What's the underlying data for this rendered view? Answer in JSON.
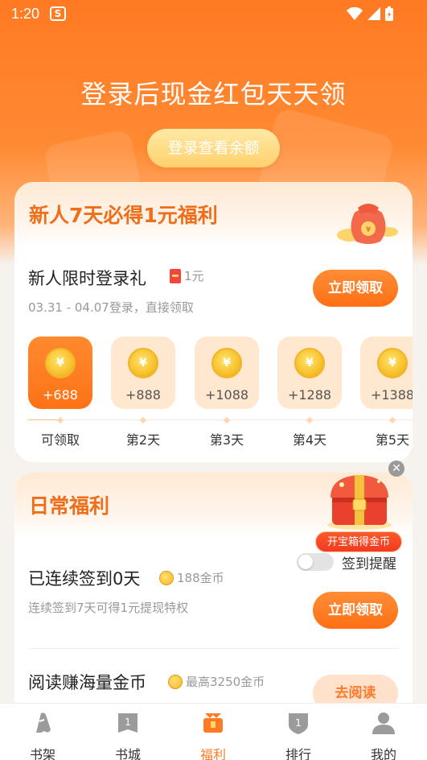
{
  "status_bar": {
    "time": "1:20",
    "app_icon_letter": "S"
  },
  "hero": {
    "title": "登录后现金红包天天领",
    "login_button": "登录查看余额"
  },
  "newbie_card": {
    "title": "新人7天必得1元福利",
    "task_title": "新人限时登录礼",
    "reward_tag": "1元",
    "subtitle": "03.31 - 04.07登录，直接领取",
    "button": "立即领取",
    "coin_symbol": "¥",
    "days": [
      {
        "amount": "+688",
        "label": "可领取",
        "active": true
      },
      {
        "amount": "+888",
        "label": "第2天"
      },
      {
        "amount": "+1088",
        "label": "第3天"
      },
      {
        "amount": "+1288",
        "label": "第4天"
      },
      {
        "amount": "+1388",
        "label": "第5天"
      }
    ]
  },
  "daily_card": {
    "title": "日常福利",
    "reminder_label": "签到提醒",
    "treasure_label": "开宝箱得金币",
    "checkin": {
      "title": "已连续签到0天",
      "coins": "188金币",
      "subtitle": "连续签到7天可得1元提现特权",
      "button": "立即领取"
    },
    "reading": {
      "title": "阅读赚海量金币",
      "coins": "最高3250金币",
      "button": "去阅读"
    }
  },
  "tabbar": {
    "items": [
      {
        "label": "书架",
        "icon": "bookshelf-icon"
      },
      {
        "label": "书城",
        "icon": "bookstore-icon"
      },
      {
        "label": "福利",
        "icon": "gift-icon",
        "active": true
      },
      {
        "label": "排行",
        "icon": "ranking-icon"
      },
      {
        "label": "我的",
        "icon": "profile-icon"
      }
    ]
  },
  "colors": {
    "accent": "#ff7a22",
    "title_orange": "#ef6e1a"
  }
}
